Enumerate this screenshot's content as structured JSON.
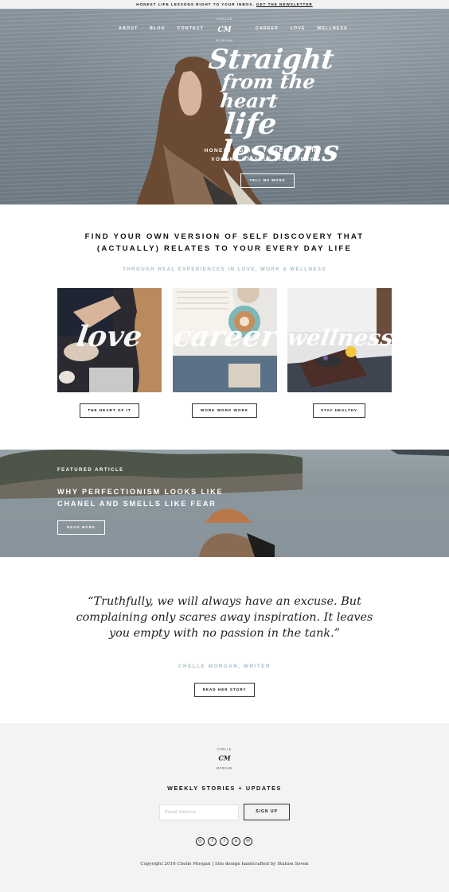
{
  "topbar": {
    "text": "HONEST LIFE LESSONS RIGHT TO YOUR INBOX.",
    "link": "GET THE NEWSLETTER"
  },
  "logo": {
    "name": "CHELLE MORGAN",
    "initials": "CM"
  },
  "nav": {
    "left": [
      "ABOUT",
      "BLOG",
      "CONTACT"
    ],
    "right": [
      "CAREER",
      "LOVE",
      "WELLNESS"
    ]
  },
  "hero": {
    "script_line1": "Straight",
    "script_line2": "from the heart",
    "script_line3": "life lessons",
    "subtitle_line1": "HONEST ADVICE TO TURN UP THE",
    "subtitle_line2": "VOLUME ON SELF DISCOVERY",
    "button": "TELL ME MORE"
  },
  "discovery": {
    "title_line1": "FIND YOUR OWN VERSION OF SELF DISCOVERY THAT",
    "title_line2": "(ACTUALLY) RELATES TO YOUR EVERY DAY LIFE",
    "subtitle": "THROUGH REAL EXPERIENCES IN LOVE, WORK & WELLNESS",
    "cards": [
      {
        "word": "love",
        "button": "THE HEART OF IT"
      },
      {
        "word": "career",
        "button": "WORK WORK WORK"
      },
      {
        "word": "wellness",
        "button": "STAY HEALTHY"
      }
    ]
  },
  "featured": {
    "label": "FEATURED ARTICLE",
    "title_line1": "WHY PERFECTIONISM LOOKS LIKE",
    "title_line2": "CHANEL AND SMELLS LIKE FEAR",
    "button": "READ MORE"
  },
  "quote": {
    "text": "“Truthfully, we will always have an excuse. But complaining only scares away inspiration. It leaves you empty with no passion in the tank.”",
    "author": "CHELLE MORGAN, WRITER",
    "button": "READ HER STORY"
  },
  "footer": {
    "title": "WEEKLY STORIES + UPDATES",
    "email_placeholder": "Email Address",
    "signup_button": "SIGN UP",
    "social_icons": [
      "instagram-icon",
      "facebook-icon",
      "twitter-icon",
      "pinterest-icon",
      "email-icon"
    ],
    "social_glyphs": [
      "◎",
      "f",
      "t",
      "p",
      "✉"
    ],
    "copyright": "Copyright 2016 Chelle Morgan | Site design handcrafted by Station Seven"
  },
  "colors": {
    "accent_muted": "#a9bdc6",
    "footer_bg": "#f3f3f3",
    "text": "#111111"
  }
}
